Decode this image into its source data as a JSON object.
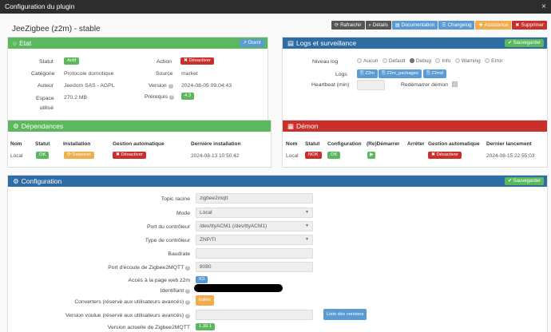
{
  "window": {
    "title": "Configuration du plugin",
    "close_glyph": "×"
  },
  "plugin": {
    "title": "JeeZigbee (z2m) - stable"
  },
  "toolbar": [
    {
      "label": "Rafraichir",
      "icon": "refresh-icon",
      "color": "#555555"
    },
    {
      "label": "Détails",
      "icon": "search-icon",
      "color": "#555555"
    },
    {
      "label": "Documentation",
      "icon": "book-icon",
      "color": "#5b9bd5"
    },
    {
      "label": "Changelog",
      "icon": "list-icon",
      "color": "#5b9bd5"
    },
    {
      "label": "Assistance",
      "icon": "ambulance-icon",
      "color": "#f0ad4e"
    },
    {
      "label": "Supprimer",
      "icon": "trash-icon",
      "color": "#c9302c"
    }
  ],
  "etat": {
    "title": "Etat",
    "header_color": "#5cb85c",
    "open_label": "Ouvrir",
    "statut_label": "Statut",
    "statut_value": "Actif",
    "categorie_label": "Catégorie",
    "categorie_value": "Protocole domotique",
    "auteur_label": "Auteur",
    "auteur_value": "Jeedom SAS - AGPL",
    "espace_label": "Espace utilisé",
    "espace_value": "270.2 MB",
    "action_label": "Action",
    "action_value": "Désactiver",
    "source_label": "Source",
    "source_value": "market",
    "version_label": "Version",
    "version_value": "2024-08-05 09:04:43",
    "prerequis_label": "Prérequis",
    "prerequis_value": "4.3"
  },
  "logs": {
    "title": "Logs et surveillance",
    "header_color": "#2e6da4",
    "save_label": "Sauvegarder",
    "niveau_label": "Niveau log",
    "levels": [
      "Aucun",
      "Default",
      "Debug",
      "Info",
      "Warning",
      "Error"
    ],
    "selected_level": "Debug",
    "logs_label": "Logs",
    "log_buttons": [
      "Z2m",
      "Z2m_packages",
      "Z2md"
    ],
    "heartbeat_label": "Heartbeat (min)",
    "redemarrer_label": "Redémarrer démon"
  },
  "dependances": {
    "title": "Dépendances",
    "header_color": "#5cb85c",
    "headers": [
      "Nom",
      "Statut",
      "Installation",
      "Gestion automatique",
      "Dernière installation"
    ],
    "row": {
      "nom": "Local",
      "statut": "OK",
      "installation": "Relancer",
      "gestion": "Désactiver",
      "derniere": "2024-08-13 10:50:42"
    }
  },
  "demon": {
    "title": "Démon",
    "header_color": "#c9302c",
    "headers": [
      "Nom",
      "Statut",
      "Configuration",
      "(Re)Démarrer",
      "Arrêter",
      "Gestion automatique",
      "Dernier lancement"
    ],
    "row": {
      "nom": "Local",
      "statut": "NOK",
      "configuration": "OK",
      "gestion": "Désactiver",
      "dernier": "2024-08-15 22:55:03"
    }
  },
  "configuration": {
    "title": "Configuration",
    "header_color": "#2e6da4",
    "save_label": "Sauvegarder",
    "fields": {
      "topic_label": "Topic racine",
      "topic_value": "zigbee2mqtt",
      "mode_label": "Mode",
      "mode_value": "Local",
      "port_label": "Port du contrôleur",
      "port_value": "/dev/ttyACM1 (/dev/ttyACM1)",
      "type_label": "Type de contrôleur",
      "type_value": "ZNP/TI",
      "baudrate_label": "Baudrate",
      "baudrate_value": "",
      "ecoute_label": "Port d'écoute de Zigbee2MQTT",
      "ecoute_value": "8080",
      "acces_label": "Accès à la page web z2m",
      "acces_value": "ICI",
      "identifiant_label": "Identifiant",
      "converters_label": "Converters (réservé aux utilisateurs avancés)",
      "converters_value": "Editer",
      "version_voulue_label": "Version voulue (réservé aux utilisateurs avancés)",
      "versions_button": "Liste des versions",
      "version_actuelle_label": "Version actuelle de Zigbee2MQTT",
      "version_actuelle_value": "1.39.1"
    }
  }
}
